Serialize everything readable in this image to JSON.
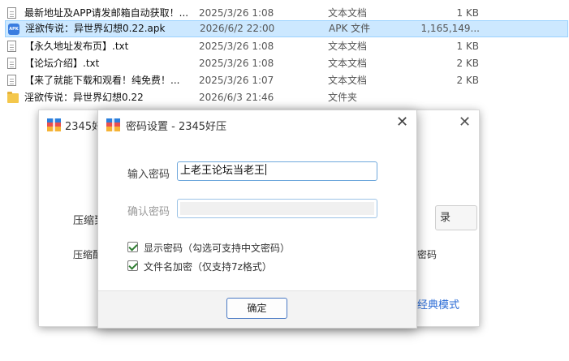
{
  "files": [
    {
      "icon": "doc-icon",
      "name": "最新地址及APP请发邮箱自动获取！...",
      "date": "2025/3/26 1:08",
      "type": "文本文档",
      "size": "1 KB",
      "selected": false
    },
    {
      "icon": "apk-icon",
      "name": "淫欲传说：异世界幻想0.22.apk",
      "date": "2026/6/2 22:00",
      "type": "APK 文件",
      "size": "1,165,149...",
      "selected": true
    },
    {
      "icon": "doc-icon",
      "name": "【永久地址发布页】.txt",
      "date": "2025/3/26 1:08",
      "type": "文本文档",
      "size": "1 KB",
      "selected": false
    },
    {
      "icon": "doc-icon",
      "name": "【论坛介绍】.txt",
      "date": "2025/3/26 1:08",
      "type": "文本文档",
      "size": "2 KB",
      "selected": false
    },
    {
      "icon": "doc-icon",
      "name": "【来了就能下载和观看！纯免费！...",
      "date": "2025/3/26 1:07",
      "type": "文本文档",
      "size": "2 KB",
      "selected": false
    },
    {
      "icon": "folder-icon",
      "name": "淫欲传说：异世界幻想0.22",
      "date": "2026/6/3 21:46",
      "type": "文件夹",
      "size": "",
      "selected": false
    }
  ],
  "back_window": {
    "title": "2345好",
    "text1": "压缩到",
    "text2": "压缩配",
    "button_label": "录",
    "right_text": "密码",
    "link_text": "经典模式"
  },
  "dialog": {
    "title": "密码设置 - 2345好压",
    "password_label": "输入密码",
    "password_value": "上老王论坛当老王",
    "confirm_label": "确认密码",
    "confirm_value": "",
    "show_password_label": "显示密码（勾选可支持中文密码）",
    "show_password_checked": true,
    "encrypt_names_label": "文件名加密（仅支持7z格式）",
    "encrypt_names_checked": true,
    "ok_label": "确定"
  },
  "icons": {
    "close": "close-icon",
    "app_logo": "2345-logo-icon"
  },
  "colors": {
    "selection": "#cce8ff",
    "accent": "#2a6bd6",
    "check": "#2f7d32"
  }
}
